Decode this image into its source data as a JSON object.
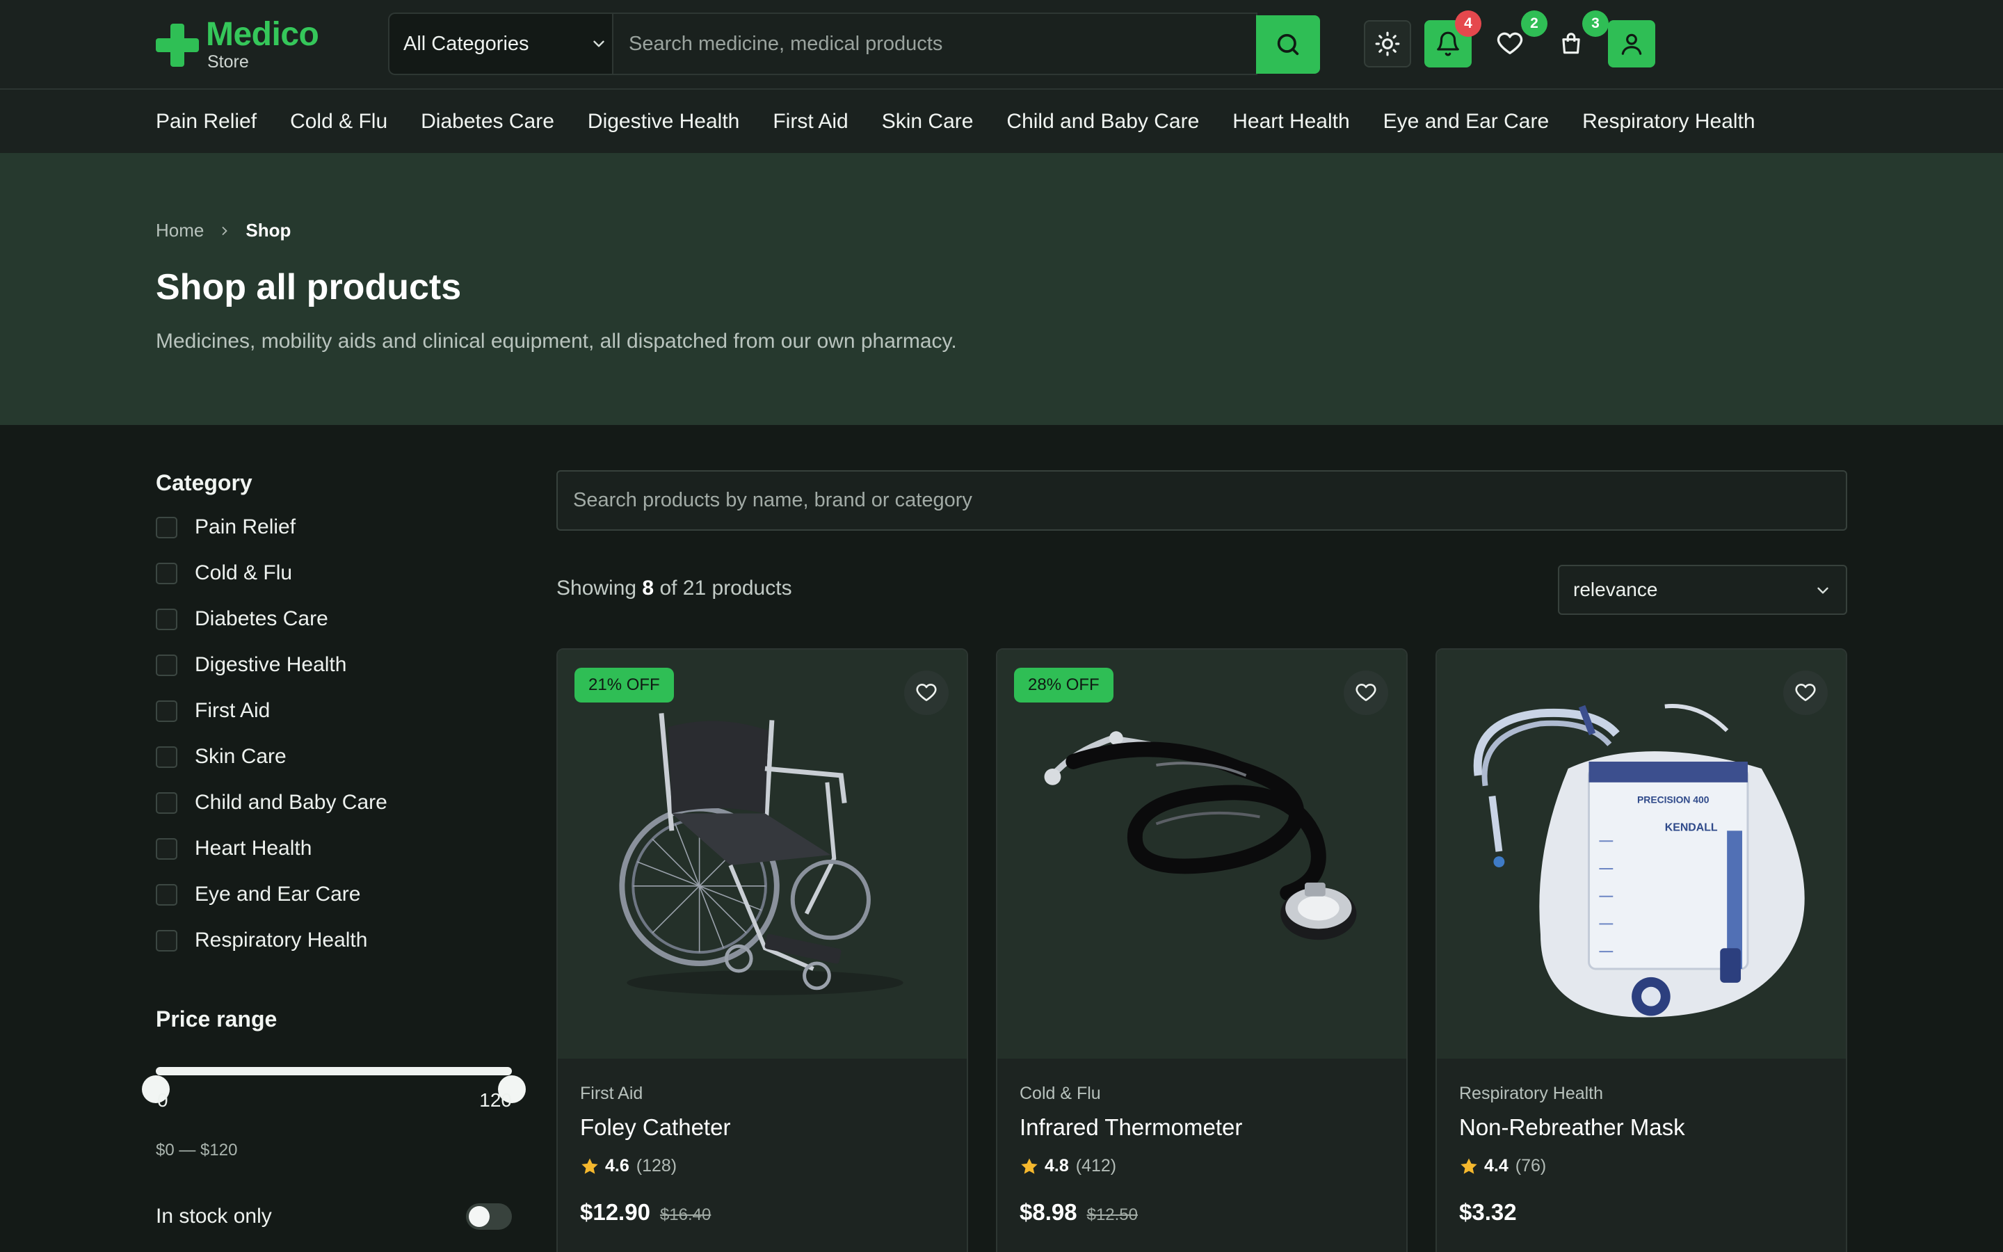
{
  "brand": {
    "name": "Medico",
    "sub": "Store"
  },
  "header": {
    "category_select": "All Categories",
    "search_placeholder": "Search medicine, medical products",
    "badges": {
      "notifications": "4",
      "wishlist": "2",
      "cart": "3"
    }
  },
  "nav": [
    "Pain Relief",
    "Cold & Flu",
    "Diabetes Care",
    "Digestive Health",
    "First Aid",
    "Skin Care",
    "Child and Baby Care",
    "Heart Health",
    "Eye and Ear Care",
    "Respiratory Health"
  ],
  "hero": {
    "breadcrumb": {
      "home": "Home",
      "current": "Shop"
    },
    "title": "Shop all products",
    "subtitle": "Medicines, mobility aids and clinical equipment, all dispatched from our own pharmacy."
  },
  "filters": {
    "category_title": "Category",
    "categories": [
      "Pain Relief",
      "Cold & Flu",
      "Diabetes Care",
      "Digestive Health",
      "First Aid",
      "Skin Care",
      "Child and Baby Care",
      "Heart Health",
      "Eye and Ear Care",
      "Respiratory Health"
    ],
    "price_title": "Price range",
    "price_min": "0",
    "price_max": "120",
    "price_text": "$0 — $120",
    "instock_label": "In stock only"
  },
  "results": {
    "search_placeholder": "Search products by name, brand or category",
    "showing_prefix": "Showing",
    "showing_count": "8",
    "showing_suffix": "of 21 products",
    "sort": "relevance"
  },
  "products": [
    {
      "discount": "21% OFF",
      "category": "First Aid",
      "name": "Foley Catheter",
      "rating": "4.6",
      "reviews": "(128)",
      "price": "$12.90",
      "old_price": "$16.40"
    },
    {
      "discount": "28% OFF",
      "category": "Cold & Flu",
      "name": "Infrared Thermometer",
      "rating": "4.8",
      "reviews": "(412)",
      "price": "$8.98",
      "old_price": "$12.50"
    },
    {
      "discount": "",
      "category": "Respiratory Health",
      "name": "Non-Rebreather Mask",
      "rating": "4.4",
      "reviews": "(76)",
      "price": "$3.32",
      "old_price": ""
    }
  ],
  "colors": {
    "accent": "#2fbe55",
    "badge_alert": "#e5484d",
    "hero_bg": "#26392e",
    "page_bg": "#141a17"
  }
}
